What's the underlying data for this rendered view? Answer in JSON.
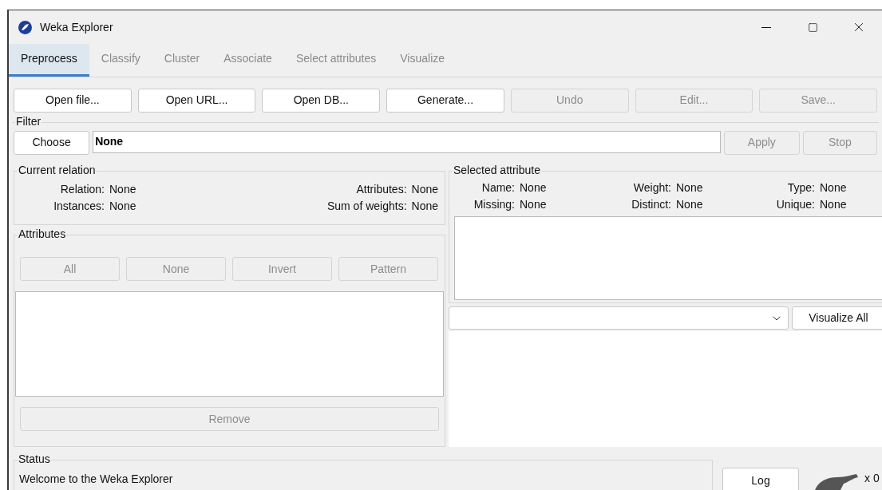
{
  "window": {
    "title": "Weka Explorer"
  },
  "tabs": [
    {
      "label": "Preprocess",
      "selected": true
    },
    {
      "label": "Classify",
      "selected": false
    },
    {
      "label": "Cluster",
      "selected": false
    },
    {
      "label": "Associate",
      "selected": false
    },
    {
      "label": "Select attributes",
      "selected": false
    },
    {
      "label": "Visualize",
      "selected": false
    }
  ],
  "toolbar": [
    {
      "label": "Open file...",
      "disabled": false
    },
    {
      "label": "Open URL...",
      "disabled": false
    },
    {
      "label": "Open DB...",
      "disabled": false
    },
    {
      "label": "Generate...",
      "disabled": false
    },
    {
      "label": "Undo",
      "disabled": true
    },
    {
      "label": "Edit...",
      "disabled": true
    },
    {
      "label": "Save...",
      "disabled": true
    }
  ],
  "filter": {
    "title": "Filter",
    "choose": {
      "label": "Choose",
      "disabled": false
    },
    "value": "None",
    "apply": {
      "label": "Apply",
      "disabled": true
    },
    "stop": {
      "label": "Stop",
      "disabled": true
    }
  },
  "current_relation": {
    "title": "Current relation",
    "left": [
      {
        "label": "Relation:",
        "value": "None"
      },
      {
        "label": "Instances:",
        "value": "None"
      }
    ],
    "right": [
      {
        "label": "Attributes:",
        "value": "None"
      },
      {
        "label": "Sum of weights:",
        "value": "None"
      }
    ]
  },
  "attributes": {
    "title": "Attributes",
    "buttons": [
      {
        "label": "All",
        "disabled": true
      },
      {
        "label": "None",
        "disabled": true
      },
      {
        "label": "Invert",
        "disabled": true
      },
      {
        "label": "Pattern",
        "disabled": true
      }
    ],
    "remove": {
      "label": "Remove",
      "disabled": true
    }
  },
  "selected_attribute": {
    "title": "Selected attribute",
    "columns": [
      [
        {
          "label": "Name:",
          "value": "None"
        },
        {
          "label": "Missing:",
          "value": "None"
        }
      ],
      [
        {
          "label": "Weight:",
          "value": "None"
        },
        {
          "label": "Distinct:",
          "value": "None"
        }
      ],
      [
        {
          "label": "Type:",
          "value": "None"
        },
        {
          "label": "Unique:",
          "value": "None"
        }
      ]
    ],
    "visualize_all": {
      "label": "Visualize All",
      "disabled": false
    }
  },
  "status": {
    "title": "Status",
    "message": "Welcome to the Weka Explorer",
    "log": {
      "label": "Log",
      "disabled": false
    },
    "count": "x 0"
  }
}
